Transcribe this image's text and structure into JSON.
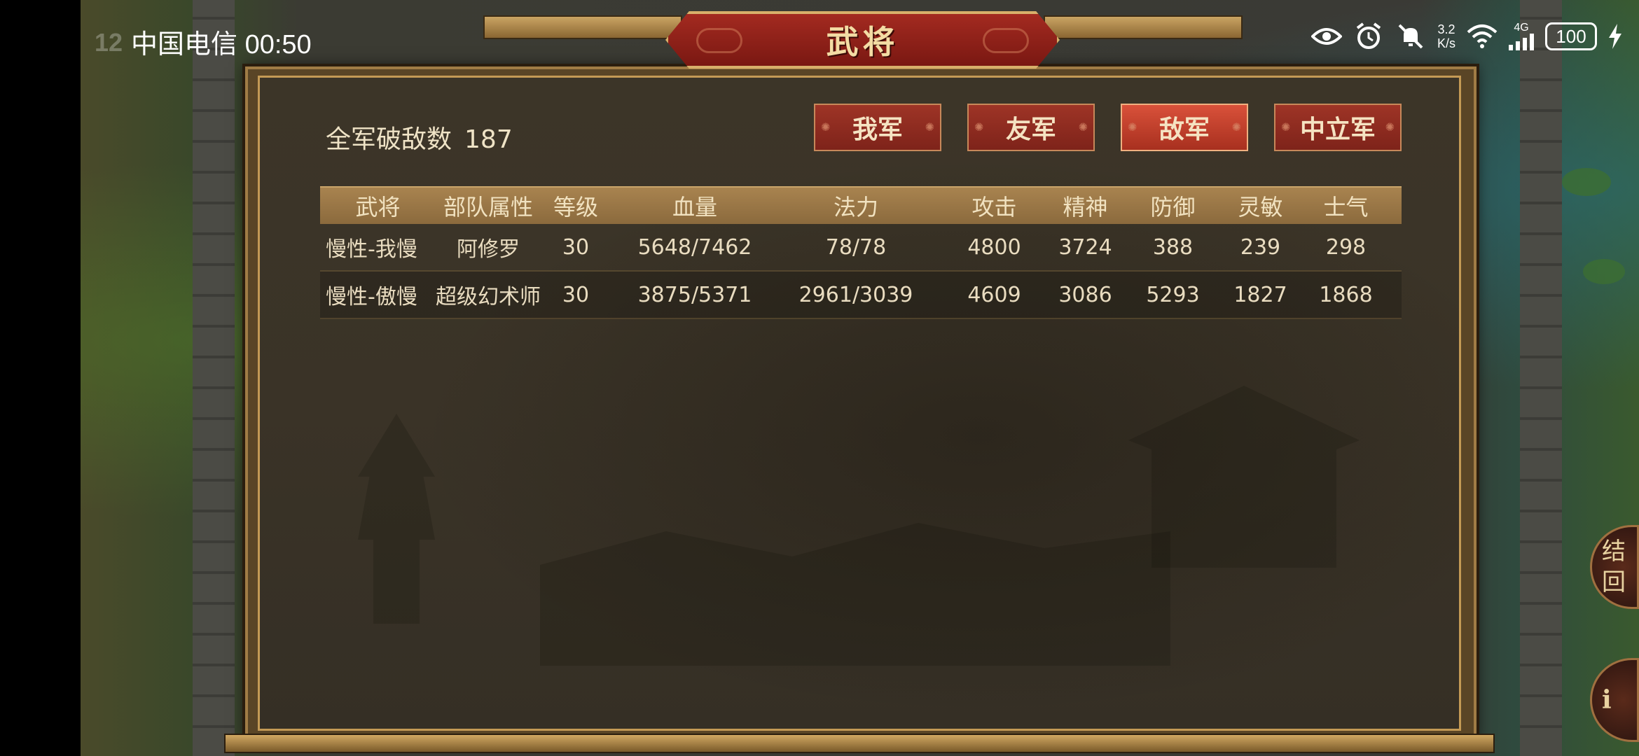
{
  "status_bar": {
    "carrier": "中国电信",
    "time": "00:50",
    "net_speed_value": "3.2",
    "net_speed_unit": "K/s",
    "network": "4G",
    "battery": "100"
  },
  "background": {
    "ghost_number": "12"
  },
  "window": {
    "title": "武将"
  },
  "summary": {
    "kill_label": "全军破敌数",
    "kill_count": "187"
  },
  "tabs": [
    {
      "label": "我军",
      "active": false
    },
    {
      "label": "友军",
      "active": false
    },
    {
      "label": "敌军",
      "active": true
    },
    {
      "label": "中立军",
      "active": false
    }
  ],
  "table": {
    "headers": [
      "武将",
      "部队属性",
      "等级",
      "血量",
      "法力",
      "攻击",
      "精神",
      "防御",
      "灵敏",
      "士气"
    ],
    "rows": [
      [
        "慢性-我慢",
        "阿修罗",
        "30",
        "5648/7462",
        "78/78",
        "4800",
        "3724",
        "388",
        "239",
        "298"
      ],
      [
        "慢性-傲慢",
        "超级幻术师",
        "30",
        "3875/5371",
        "2961/3039",
        "4609",
        "3086",
        "5293",
        "1827",
        "1868"
      ]
    ]
  },
  "side_buttons": {
    "top_label": "结",
    "top_label2": "回",
    "bottom_label": "i"
  }
}
